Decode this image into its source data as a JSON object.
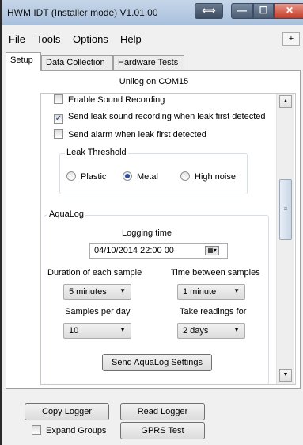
{
  "window": {
    "title": "HWM IDT (Installer mode) V1.01.00",
    "controls": {
      "arrows": "⟺",
      "minimize": "—",
      "maximize": "☐",
      "close": "✕"
    }
  },
  "menu": {
    "items": [
      "File",
      "Tools",
      "Options",
      "Help"
    ],
    "plus": "+"
  },
  "tabs": [
    "Setup",
    "Data Collection",
    "Hardware Tests"
  ],
  "device_label": "Unilog on COM15",
  "sound": {
    "enable_recording": {
      "label": "Enable Sound Recording",
      "checked": false
    },
    "send_on_leak": {
      "label": "Send leak sound recording when leak first detected",
      "checked": true
    },
    "send_alarm": {
      "label": "Send alarm when leak first detected",
      "checked": false
    }
  },
  "leak_threshold": {
    "legend": "Leak Threshold",
    "options": [
      "Plastic",
      "Metal",
      "High noise"
    ],
    "selected": "Metal"
  },
  "aqualog": {
    "legend": "AquaLog",
    "logging_time_label": "Logging time",
    "logging_time_value": "04/10/2014    22:00 00",
    "duration_label": "Duration of each sample",
    "duration_value": "5 minutes",
    "between_label": "Time between samples",
    "between_value": "1 minute",
    "samples_label": "Samples per day",
    "samples_value": "10",
    "readings_label": "Take readings for",
    "readings_value": "2 days",
    "send_button": "Send AquaLog Settings"
  },
  "bottom": {
    "copy_logger": "Copy Logger",
    "read_logger": "Read Logger",
    "expand_groups": {
      "label": "Expand Groups",
      "checked": false
    },
    "gprs_test": "GPRS Test"
  },
  "icons": {
    "calendar": "calendar-icon",
    "dropdown": "chevron-down-icon",
    "scroll_up": "arrow-up-icon",
    "scroll_down": "arrow-down-icon"
  },
  "colors": {
    "titlebar": "#b6c9e2",
    "close": "#c43b25",
    "radio_selected": "#2b4c9b"
  }
}
